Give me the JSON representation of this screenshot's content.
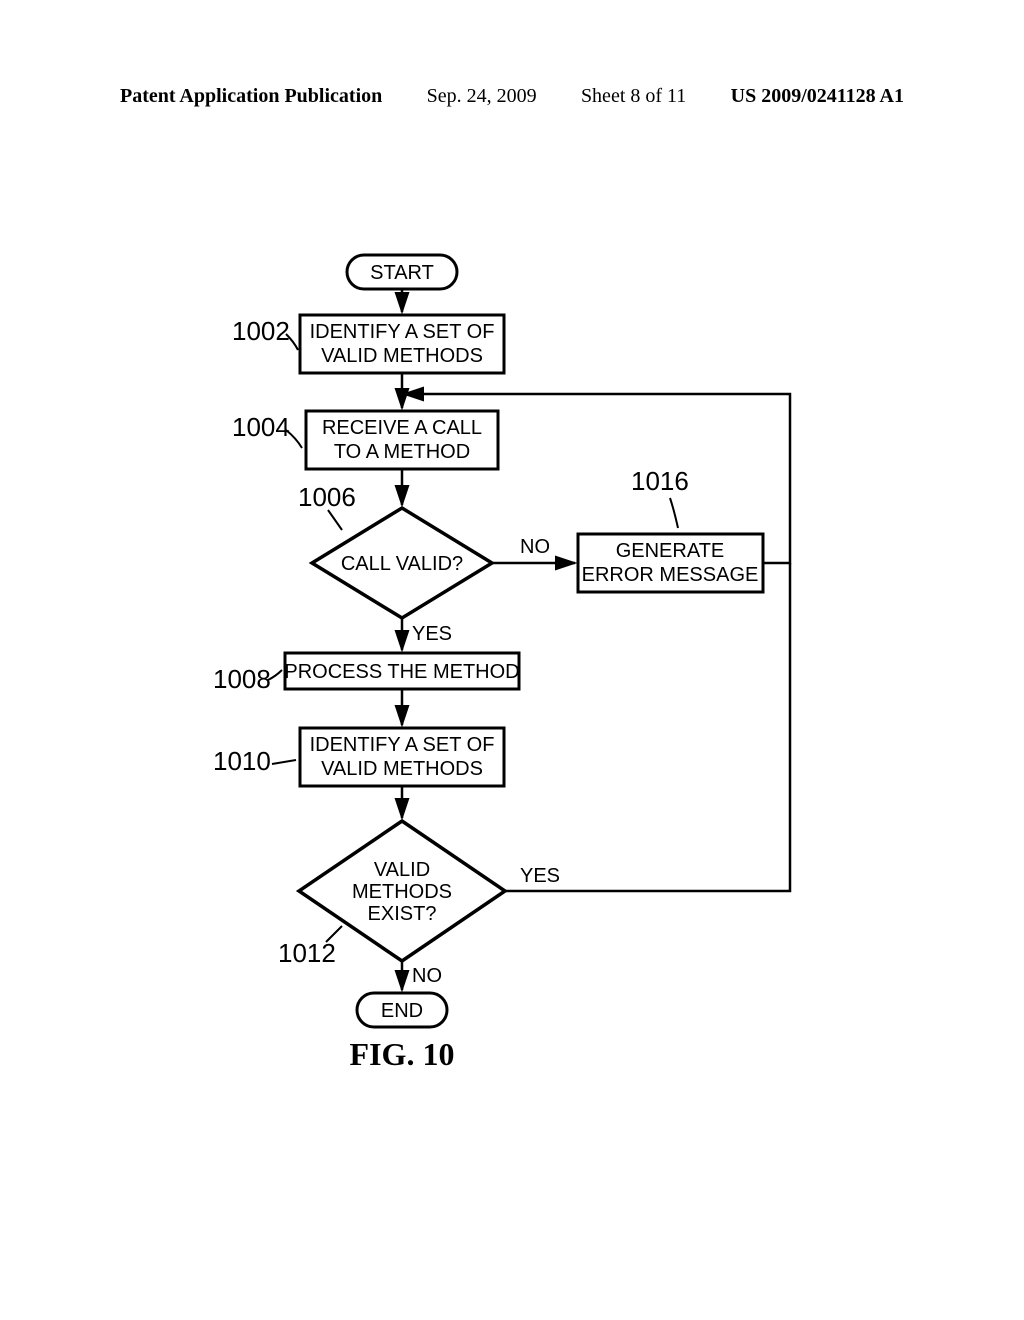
{
  "header": {
    "pub_label": "Patent Application Publication",
    "date": "Sep. 24, 2009",
    "sheet": "Sheet 8 of 11",
    "docnum": "US 2009/0241128 A1"
  },
  "chart_data": {
    "type": "flowchart",
    "figure_label": "FIG. 10",
    "nodes": [
      {
        "id": "start",
        "shape": "terminator",
        "text": "START"
      },
      {
        "id": "n1002",
        "ref": "1002",
        "shape": "process",
        "text": "IDENTIFY A SET OF\nVALID METHODS"
      },
      {
        "id": "n1004",
        "ref": "1004",
        "shape": "process",
        "text": "RECEIVE A CALL\nTO A METHOD"
      },
      {
        "id": "n1006",
        "ref": "1006",
        "shape": "decision",
        "text": "CALL VALID?"
      },
      {
        "id": "n1008",
        "ref": "1008",
        "shape": "process",
        "text": "PROCESS THE METHOD"
      },
      {
        "id": "n1010",
        "ref": "1010",
        "shape": "process",
        "text": "IDENTIFY A SET OF\nVALID METHODS"
      },
      {
        "id": "n1012",
        "ref": "1012",
        "shape": "decision",
        "text": "VALID\nMETHODS\nEXIST?"
      },
      {
        "id": "n1016",
        "ref": "1016",
        "shape": "process",
        "text": "GENERATE\nERROR MESSAGE"
      },
      {
        "id": "end",
        "shape": "terminator",
        "text": "END"
      }
    ],
    "edges": [
      {
        "from": "start",
        "to": "n1002"
      },
      {
        "from": "n1002",
        "to": "n1004"
      },
      {
        "from": "n1004",
        "to": "n1006"
      },
      {
        "from": "n1006",
        "to": "n1008",
        "label": "YES"
      },
      {
        "from": "n1006",
        "to": "n1016",
        "label": "NO"
      },
      {
        "from": "n1008",
        "to": "n1010"
      },
      {
        "from": "n1010",
        "to": "n1012"
      },
      {
        "from": "n1012",
        "to": "end",
        "label": "NO"
      },
      {
        "from": "n1012",
        "to": "n1004",
        "label": "YES",
        "feedback": true
      },
      {
        "from": "n1016",
        "to": "n1004",
        "feedback": true
      }
    ]
  },
  "labels": {
    "yes": "YES",
    "no": "NO"
  }
}
